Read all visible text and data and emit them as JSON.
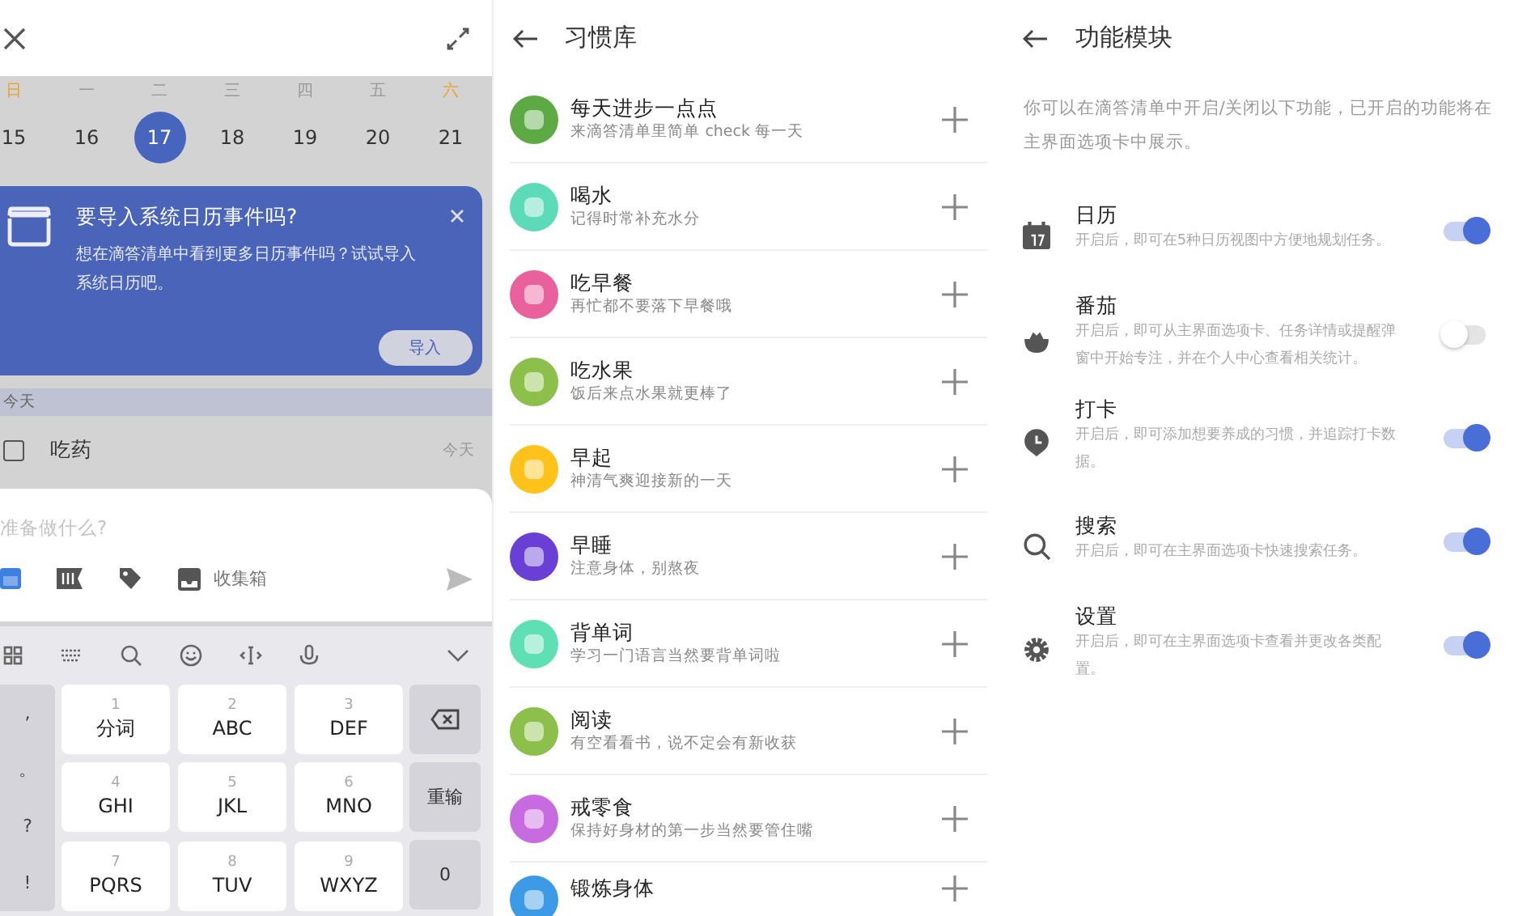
{
  "calendar_screen": {
    "calendar": {
      "weekdays": [
        {
          "label": "日",
          "weekend": true
        },
        {
          "label": "一",
          "weekend": false
        },
        {
          "label": "二",
          "weekend": false
        },
        {
          "label": "三",
          "weekend": false
        },
        {
          "label": "四",
          "weekend": false
        },
        {
          "label": "五",
          "weekend": false
        },
        {
          "label": "六",
          "weekend": true
        }
      ],
      "days": [
        {
          "label": "15",
          "selected": false
        },
        {
          "label": "16",
          "selected": false
        },
        {
          "label": "17",
          "selected": true
        },
        {
          "label": "18",
          "selected": false
        },
        {
          "label": "19",
          "selected": false
        },
        {
          "label": "20",
          "selected": false
        },
        {
          "label": "21",
          "selected": false
        }
      ]
    },
    "import_banner": {
      "title": "要导入系统日历事件吗?",
      "body": "想在滴答清单中看到更多日历事件吗？试试导入系统日历吧。",
      "button": "导入"
    },
    "section": "今天",
    "task": {
      "title": "吃药",
      "checked": false,
      "due": "今天"
    },
    "quick_add": {
      "placeholder": "准备做什么?",
      "list_label": "收集箱"
    },
    "keyboard": {
      "side_keys": [
        ",",
        "。",
        "?",
        "!"
      ],
      "keys": [
        {
          "number": "1",
          "letters": "分词"
        },
        {
          "number": "2",
          "letters": "ABC"
        },
        {
          "number": "3",
          "letters": "DEF"
        },
        {
          "number": "4",
          "letters": "GHI"
        },
        {
          "number": "5",
          "letters": "JKL"
        },
        {
          "number": "6",
          "letters": "MNO"
        },
        {
          "number": "7",
          "letters": "PQRS"
        },
        {
          "number": "8",
          "letters": "TUV"
        },
        {
          "number": "9",
          "letters": "WXYZ"
        }
      ],
      "reset_key": "重输",
      "zero_key": "0"
    }
  },
  "habit_library": {
    "title": "习惯库",
    "habits": [
      {
        "name": "每天进步一点点",
        "desc": "来滴答清单里简单 check 每一天",
        "color": "#5daa45"
      },
      {
        "name": "喝水",
        "desc": "记得时常补充水分",
        "color": "#5ddbb8"
      },
      {
        "name": "吃早餐",
        "desc": "再忙都不要落下早餐哦",
        "color": "#e8609c"
      },
      {
        "name": "吃水果",
        "desc": "饭后来点水果就更棒了",
        "color": "#8cc04a"
      },
      {
        "name": "早起",
        "desc": "神清气爽迎接新的一天",
        "color": "#ffc21a"
      },
      {
        "name": "早睡",
        "desc": "注意身体，别熬夜",
        "color": "#6a3fd6"
      },
      {
        "name": "背单词",
        "desc": "学习一门语言当然要背单词啦",
        "color": "#5fe0b4"
      },
      {
        "name": "阅读",
        "desc": "有空看看书，说不定会有新收获",
        "color": "#8cc04a"
      },
      {
        "name": "戒零食",
        "desc": "保持好身材的第一步当然要管住嘴",
        "color": "#c86ae0"
      },
      {
        "name": "锻炼身体",
        "color": "#3d9ae6"
      }
    ]
  },
  "feature_modules": {
    "title": "功能模块",
    "intro": "你可以在滴答清单中开启/关闭以下功能，已开启的功能将在主界面选项卡中展示。",
    "features": [
      {
        "name": "日历",
        "desc": "开启后，即可在5种日历视图中方便地规划任务。",
        "on": true
      },
      {
        "name": "番茄",
        "desc": "开启后，即可从主界面选项卡、任务详情或提醒弹窗中开始专注，并在个人中心查看相关统计。",
        "on": false
      },
      {
        "name": "打卡",
        "desc": "开启后，即可添加想要养成的习惯，并追踪打卡数据。",
        "on": true
      },
      {
        "name": "搜索",
        "desc": "开启后，即可在主界面选项卡快速搜索任务。",
        "on": true
      },
      {
        "name": "设置",
        "desc": "开启后，即可在主界面选项卡查看并更改各类配置。",
        "on": true
      }
    ]
  }
}
